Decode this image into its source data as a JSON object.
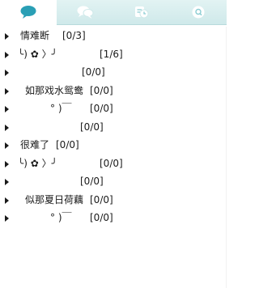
{
  "tabs": [
    {
      "name": "contacts",
      "icon": "chat-bubble-icon",
      "active": true
    },
    {
      "name": "groups",
      "icon": "double-bubble-icon",
      "active": false
    },
    {
      "name": "recent",
      "icon": "recent-history-icon",
      "active": false
    },
    {
      "name": "search",
      "icon": "search-icon",
      "active": false
    }
  ],
  "groups": [
    {
      "name": "情难断",
      "count": "[0/3]"
    },
    {
      "name": "╰) ✿ 〉╯",
      "count": "[1/6]"
    },
    {
      "name": "",
      "count": "[0/0]"
    },
    {
      "name": "如那戏水鸳鸯",
      "count": "[0/0]"
    },
    {
      "name": "° )￣",
      "count": "[0/0]"
    },
    {
      "name": "",
      "count": "[0/0]"
    },
    {
      "name": "很难了",
      "count": "[0/0]"
    },
    {
      "name": "╰) ✿ 〉╯",
      "count": "[0/0]"
    },
    {
      "name": "",
      "count": "[0/0]"
    },
    {
      "name": "似那夏日荷藕",
      "count": "[0/0]"
    },
    {
      "name": "° )￣",
      "count": "[0/0]"
    }
  ],
  "colors": {
    "accent": "#2a9fb5",
    "tab_icon_inactive": "#ffffff",
    "tabbar_bg": "#d6eeee"
  }
}
